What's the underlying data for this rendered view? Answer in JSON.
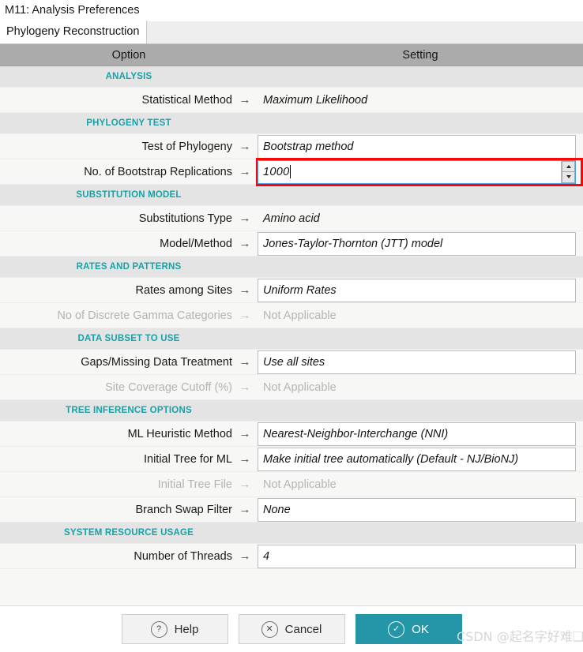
{
  "window": {
    "title": "M11: Analysis Preferences"
  },
  "tabs": [
    {
      "label": "Phylogeny Reconstruction",
      "active": true
    }
  ],
  "table": {
    "headers": {
      "option": "Option",
      "setting": "Setting"
    },
    "arrow_glyph": "→"
  },
  "sections": [
    {
      "title": "ANALYSIS",
      "rows": [
        {
          "label": "Statistical Method",
          "value": "Maximum Likelihood",
          "style": "plain",
          "disabled": false
        }
      ]
    },
    {
      "title": "PHYLOGENY TEST",
      "rows": [
        {
          "label": "Test of Phylogeny",
          "value": "Bootstrap method",
          "style": "boxed",
          "disabled": false
        },
        {
          "label": "No. of Bootstrap Replications",
          "value": "1000",
          "style": "spinner",
          "disabled": false,
          "highlighted": true
        }
      ]
    },
    {
      "title": "SUBSTITUTION MODEL",
      "rows": [
        {
          "label": "Substitutions Type",
          "value": "Amino acid",
          "style": "plain",
          "disabled": false
        },
        {
          "label": "Model/Method",
          "value": "Jones-Taylor-Thornton (JTT) model",
          "style": "boxed",
          "disabled": false
        }
      ]
    },
    {
      "title": "RATES AND PATTERNS",
      "rows": [
        {
          "label": "Rates among Sites",
          "value": "Uniform Rates",
          "style": "boxed",
          "disabled": false
        },
        {
          "label": "No of Discrete Gamma Categories",
          "value": "Not Applicable",
          "style": "na",
          "disabled": true
        }
      ]
    },
    {
      "title": "DATA SUBSET TO USE",
      "rows": [
        {
          "label": "Gaps/Missing Data Treatment",
          "value": "Use all sites",
          "style": "boxed",
          "disabled": false
        },
        {
          "label": "Site Coverage Cutoff (%)",
          "value": "Not Applicable",
          "style": "na",
          "disabled": true
        }
      ]
    },
    {
      "title": "TREE INFERENCE OPTIONS",
      "rows": [
        {
          "label": "ML Heuristic Method",
          "value": "Nearest-Neighbor-Interchange (NNI)",
          "style": "boxed",
          "disabled": false
        },
        {
          "label": "Initial Tree for ML",
          "value": "Make initial tree automatically (Default - NJ/BioNJ)",
          "style": "boxed",
          "disabled": false
        },
        {
          "label": "Initial Tree File",
          "value": "Not Applicable",
          "style": "na",
          "disabled": true
        },
        {
          "label": "Branch Swap Filter",
          "value": "None",
          "style": "boxed",
          "disabled": false
        }
      ]
    },
    {
      "title": "SYSTEM RESOURCE USAGE",
      "rows": [
        {
          "label": "Number of Threads",
          "value": "4",
          "style": "boxed",
          "disabled": false
        }
      ]
    }
  ],
  "footer": {
    "help_label": "Help",
    "help_icon": "?",
    "cancel_label": "Cancel",
    "cancel_icon": "✕",
    "ok_label": "OK",
    "ok_icon": "✓"
  },
  "watermark": "CSDN @起名字好难❑ɓ❑",
  "colors": {
    "accent_teal": "#17a2a8",
    "ok_button": "#2596a8",
    "highlight_red": "#fa0606",
    "focus_blue": "#4ba3e3",
    "header_gray": "#ababab",
    "section_band": "#e4e4e4",
    "row_bg": "#f7f7f5"
  }
}
